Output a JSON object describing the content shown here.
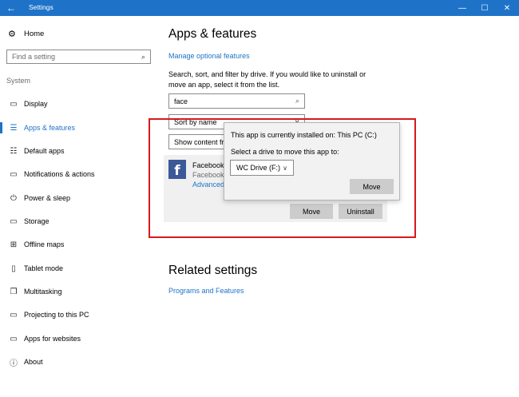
{
  "window": {
    "title": "Settings",
    "back_glyph": "←",
    "min_glyph": "—",
    "max_glyph": "☐",
    "close_glyph": "✕"
  },
  "sidebar": {
    "home": {
      "label": "Home",
      "icon": "gear-icon"
    },
    "search": {
      "placeholder": "Find a setting",
      "icon": "search-icon"
    },
    "section_label": "System",
    "items": [
      {
        "label": "Display",
        "icon": "monitor-icon",
        "glyph": "▭"
      },
      {
        "label": "Apps & features",
        "icon": "list-icon",
        "glyph": "☰",
        "active": true
      },
      {
        "label": "Default apps",
        "icon": "default-apps-icon",
        "glyph": "☷"
      },
      {
        "label": "Notifications & actions",
        "icon": "notifications-icon",
        "glyph": "▭"
      },
      {
        "label": "Power & sleep",
        "icon": "power-icon",
        "glyph": "⏻"
      },
      {
        "label": "Storage",
        "icon": "storage-icon",
        "glyph": "▭"
      },
      {
        "label": "Offline maps",
        "icon": "map-icon",
        "glyph": "⊞"
      },
      {
        "label": "Tablet mode",
        "icon": "tablet-icon",
        "glyph": "▯"
      },
      {
        "label": "Multitasking",
        "icon": "multitasking-icon",
        "glyph": "❐"
      },
      {
        "label": "Projecting to this PC",
        "icon": "projecting-icon",
        "glyph": "▭"
      },
      {
        "label": "Apps for websites",
        "icon": "apps-websites-icon",
        "glyph": "▭"
      },
      {
        "label": "About",
        "icon": "info-icon",
        "glyph": "ⓘ"
      }
    ]
  },
  "main": {
    "title": "Apps & features",
    "manage_link": "Manage optional features",
    "description": "Search, sort, and filter by drive. If you would like to uninstall or move an app, select it from the list.",
    "filter_value": "face",
    "sort_value": "Sort by name",
    "show_value": "Show content from all drives",
    "app": {
      "name": "Facebook",
      "publisher": "Facebook Inc",
      "advanced_link": "Advanced options",
      "icon_letter": "f",
      "move_label": "Move",
      "uninstall_label": "Uninstall"
    },
    "popup": {
      "installed_text": "This app is currently installed on: This PC (C:)",
      "select_label": "Select a drive to move this app to:",
      "drive_value": "WC Drive (F:)",
      "move_label": "Move"
    },
    "related_title": "Related settings",
    "programs_link": "Programs and Features"
  },
  "colors": {
    "accent": "#1e73c8",
    "highlight": "#d7191c",
    "facebook": "#3b5998"
  }
}
